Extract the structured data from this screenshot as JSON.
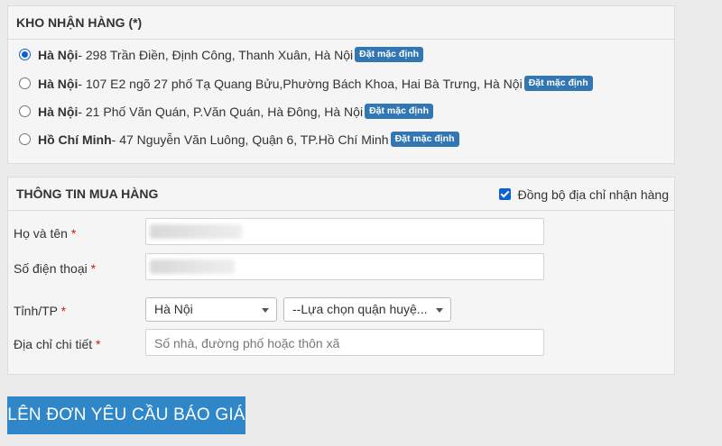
{
  "warehouse": {
    "title": "KHO NHẬN HÀNG (*)",
    "items": [
      {
        "city": "Hà Nội",
        "address": " - 298 Trần Điền, Định Công, Thanh Xuân, Hà Nội",
        "badge": "Đặt mặc định",
        "selected": true
      },
      {
        "city": "Hà Nội",
        "address": " - 107 E2 ngõ 27 phố Tạ Quang Bửu,Phường Bách Khoa, Hai Bà Trưng, Hà Nội",
        "badge": "Đặt mặc định",
        "selected": false
      },
      {
        "city": "Hà Nội",
        "address": " - 21 Phố Văn Quán, P.Văn Quán, Hà Đông, Hà Nội",
        "badge": "Đặt mặc định",
        "selected": false
      },
      {
        "city": "Hồ Chí Minh",
        "address": " - 47 Nguyễn Văn Luông, Quận 6, TP.Hồ Chí Minh",
        "badge": "Đặt mặc định",
        "selected": false
      }
    ]
  },
  "buyer": {
    "title": "THÔNG TIN MUA HÀNG",
    "sync_label": "Đồng bộ địa chỉ nhận hàng",
    "sync_checked": true,
    "name_label": "Họ và tên ",
    "phone_label": "Số điện thoại ",
    "province_label": "Tỉnh/TP ",
    "address_label": "Địa chỉ chi tiết ",
    "required_mark": "*",
    "province_value": "Hà Nội",
    "district_value": "--Lựa chọn quận huyệ...",
    "address_placeholder": "Số nhà, đường phố hoặc thôn xã"
  },
  "submit_label": "LÊN ĐƠN YÊU CẦU BÁO GIÁ",
  "colors": {
    "accent": "#2f87c9",
    "badge": "#3277b3",
    "required": "#d9141a",
    "radio_checked": "#0b62d6"
  }
}
